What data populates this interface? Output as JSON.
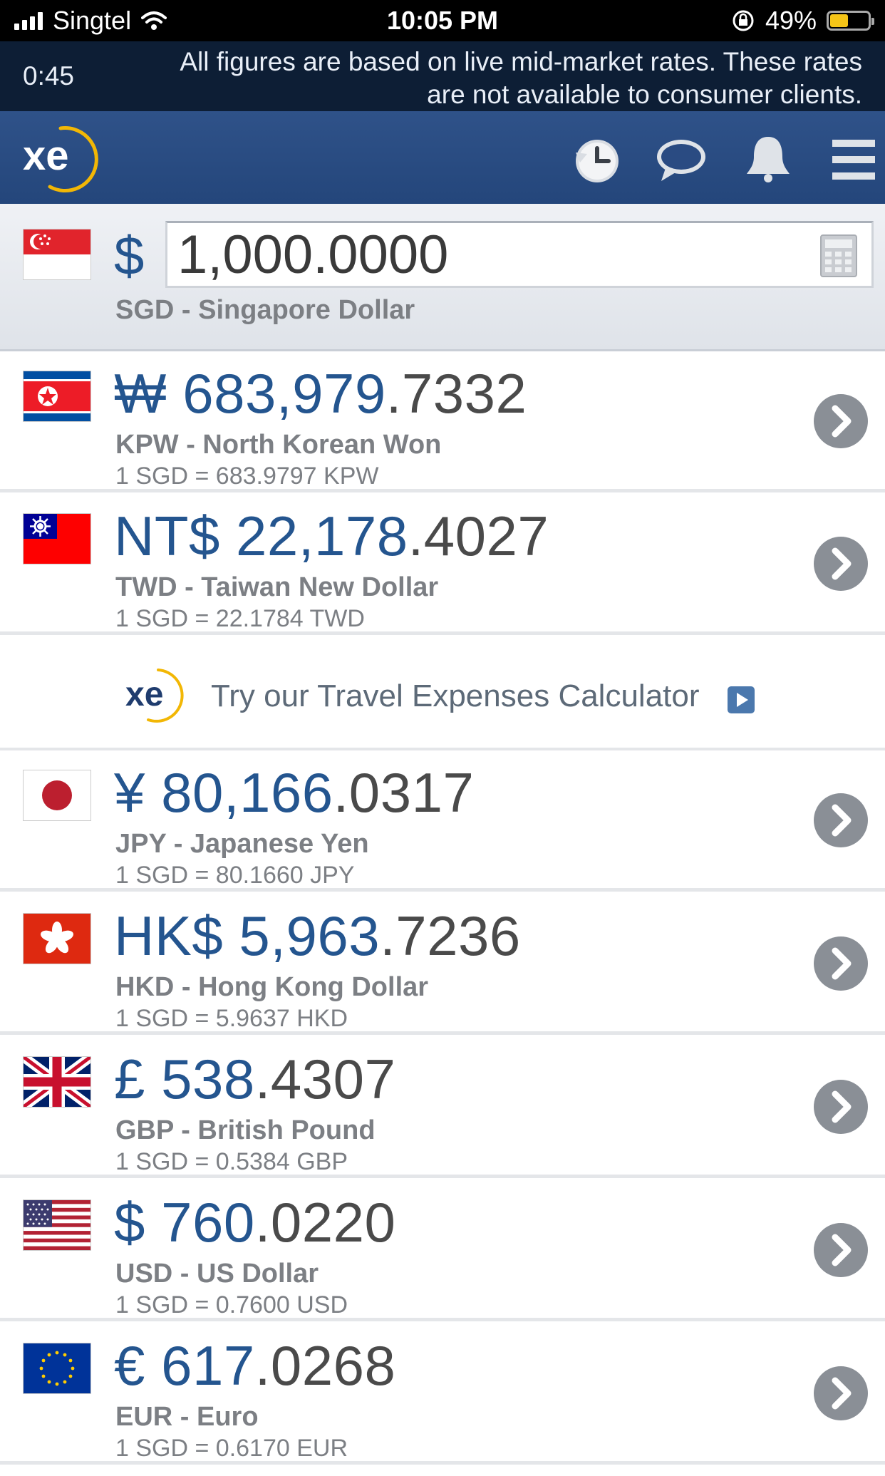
{
  "status_bar": {
    "carrier": "Singtel",
    "time": "10:05 PM",
    "battery": "49%",
    "battery_level": 0.49
  },
  "notice": {
    "timer": "0:45",
    "message": "All figures are based on live mid-market rates. These rates are not available to consumer clients."
  },
  "header": {
    "logo_text": "xe",
    "icons": [
      "history-icon",
      "chat-icon",
      "bell-icon",
      "menu-icon"
    ]
  },
  "base": {
    "symbol": "$",
    "amount": "1,000.0000",
    "name": "SGD - Singapore Dollar",
    "flag": "singapore-flag"
  },
  "promo": {
    "text": "Try our Travel Expenses Calculator",
    "logo_text": "xe"
  },
  "rows": [
    {
      "symbol": "₩",
      "int": "683,979",
      "dec": ".7332",
      "name": "KPW - North Korean Won",
      "rate": "1 SGD = 683.9797 KPW",
      "flag": "north-korea-flag"
    },
    {
      "symbol": "NT$",
      "int": "22,178",
      "dec": ".4027",
      "name": "TWD - Taiwan New Dollar",
      "rate": "1 SGD = 22.1784 TWD",
      "flag": "taiwan-flag"
    },
    {
      "symbol": "¥",
      "int": "80,166",
      "dec": ".0317",
      "name": "JPY - Japanese Yen",
      "rate": "1 SGD = 80.1660 JPY",
      "flag": "japan-flag"
    },
    {
      "symbol": "HK$",
      "int": "5,963",
      "dec": ".7236",
      "name": "HKD - Hong Kong Dollar",
      "rate": "1 SGD = 5.9637 HKD",
      "flag": "hong-kong-flag"
    },
    {
      "symbol": "£",
      "int": "538",
      "dec": ".4307",
      "name": "GBP - British Pound",
      "rate": "1 SGD = 0.5384 GBP",
      "flag": "uk-flag"
    },
    {
      "symbol": "$",
      "int": "760",
      "dec": ".0220",
      "name": "USD - US Dollar",
      "rate": "1 SGD = 0.7600 USD",
      "flag": "us-flag"
    },
    {
      "symbol": "€",
      "int": "617",
      "dec": ".0268",
      "name": "EUR - Euro",
      "rate": "1 SGD = 0.6170 EUR",
      "flag": "eu-flag"
    }
  ],
  "colors": {
    "header": "#2a4b82",
    "amount": "#24558f",
    "notice_bg": "#0d1e35",
    "logo_ring": "#f2b705"
  }
}
